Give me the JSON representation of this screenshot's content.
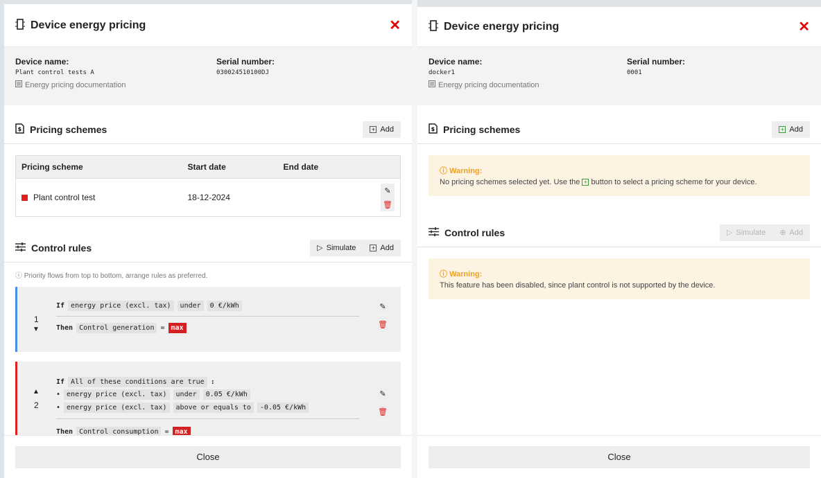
{
  "left": {
    "title": "Device energy pricing",
    "close_icon": "✕",
    "device_name_label": "Device name:",
    "device_name": "Plant control tests A",
    "serial_label": "Serial number:",
    "serial": "030024510100DJ",
    "doc_link": "Energy pricing documentation",
    "pricing_title": "Pricing schemes",
    "add_label": "Add",
    "table_headers": [
      "Pricing scheme",
      "Start date",
      "End date"
    ],
    "scheme_name": "Plant control test",
    "scheme_start": "18-12-2024",
    "scheme_end": "",
    "control_title": "Control rules",
    "simulate_label": "Simulate",
    "priority_note": "Priority flows from top to bottom, arrange rules as preferred.",
    "rule1": {
      "num": "1",
      "if": "If",
      "cond_field": "energy price (excl. tax)",
      "cond_op": "under",
      "cond_val": "0 €/kWh",
      "then": "Then",
      "action_field": "Control generation",
      "eq": "=",
      "action_val": "max"
    },
    "rule2": {
      "num": "2",
      "if": "If",
      "cond_group": "All of these conditions are true",
      "colon": ":",
      "bullet": "•",
      "c1_field": "energy price (excl. tax)",
      "c1_op": "under",
      "c1_val": "0.05 €/kWh",
      "c2_field": "energy price (excl. tax)",
      "c2_op": "above or equals to",
      "c2_val": "-0.05 €/kWh",
      "then": "Then",
      "action_field": "Control consumption",
      "eq": "=",
      "action_val": "max"
    },
    "close_label": "Close"
  },
  "right": {
    "title": "Device energy pricing",
    "close_icon": "✕",
    "device_name_label": "Device name:",
    "device_name": "docker1",
    "serial_label": "Serial number:",
    "serial": "0001",
    "doc_link": "Energy pricing documentation",
    "pricing_title": "Pricing schemes",
    "add_label": "Add",
    "warning_title": "Warning:",
    "warning1_pre": "No pricing schemes selected yet. Use the",
    "warning1_post": "button to select a pricing scheme for your device.",
    "control_title": "Control rules",
    "simulate_label": "Simulate",
    "warning2": "This feature has been disabled, since plant control is not supported by the device.",
    "close_label": "Close"
  },
  "colors": {
    "accent_red": "#e02020",
    "rule_blue": "#4a90e2",
    "warning_bg": "#fdf3e3",
    "warning_title": "#f0a020"
  }
}
